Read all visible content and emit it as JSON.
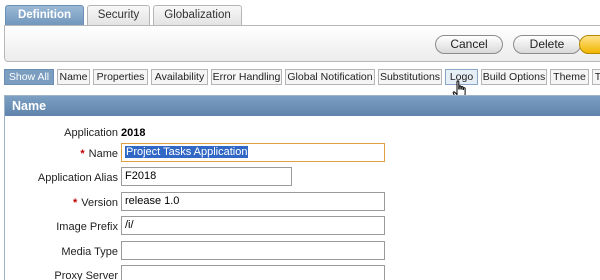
{
  "top_tabs": [
    {
      "label": "Definition",
      "active": true
    },
    {
      "label": "Security",
      "active": false
    },
    {
      "label": "Globalization",
      "active": false
    }
  ],
  "buttons": {
    "cancel": "Cancel",
    "delete": "Delete"
  },
  "sub_tabs": [
    {
      "label": "Show All",
      "active": true
    },
    {
      "label": "Name"
    },
    {
      "label": "Properties"
    },
    {
      "label": "Availability"
    },
    {
      "label": "Error Handling"
    },
    {
      "label": "Global Notification"
    },
    {
      "label": "Substitutions"
    },
    {
      "label": "Logo",
      "hover": true
    },
    {
      "label": "Build Options"
    },
    {
      "label": "Theme"
    },
    {
      "label": "T"
    }
  ],
  "region": {
    "title": "Name",
    "application_label": "Application",
    "application_id": "2018",
    "fields": {
      "name": {
        "label": "Name",
        "required": true,
        "value": "Project Tasks Application"
      },
      "alias": {
        "label": "Application Alias",
        "value": "F2018"
      },
      "version": {
        "label": "Version",
        "required": true,
        "value": "release 1.0"
      },
      "image_prefix": {
        "label": "Image Prefix",
        "value": "/i/"
      },
      "media_type": {
        "label": "Media Type",
        "value": ""
      },
      "proxy_server": {
        "label": "Proxy Server",
        "value": ""
      }
    },
    "required_marker": "*"
  },
  "colors": {
    "accent": "#6f95bb",
    "apply_button": "#f2b600",
    "required": "#c00000",
    "focus_border": "#e0a042",
    "selection": "#3168c6"
  },
  "icons": {
    "cursor": "hand-pointer-icon"
  }
}
